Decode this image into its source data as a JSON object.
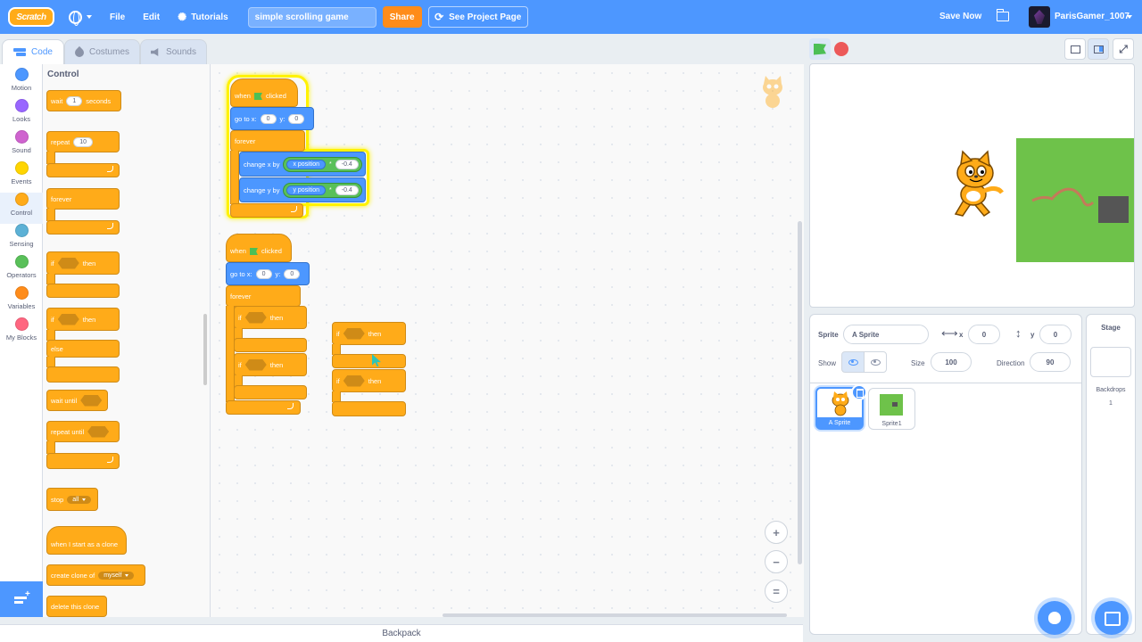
{
  "menubar": {
    "logo": "Scratch",
    "file": "File",
    "edit": "Edit",
    "tutorials": "Tutorials",
    "project_title": "simple scrolling game",
    "share": "Share",
    "see_project_page": "See Project Page",
    "save_now": "Save Now",
    "username": "ParisGamer_1007"
  },
  "tabs": {
    "code": "Code",
    "costumes": "Costumes",
    "sounds": "Sounds"
  },
  "categories": [
    {
      "label": "Motion",
      "color": "#4c97ff"
    },
    {
      "label": "Looks",
      "color": "#9966ff"
    },
    {
      "label": "Sound",
      "color": "#cf63cf"
    },
    {
      "label": "Events",
      "color": "#ffd500"
    },
    {
      "label": "Control",
      "color": "#ffab19"
    },
    {
      "label": "Sensing",
      "color": "#5cb1d6"
    },
    {
      "label": "Operators",
      "color": "#59c059"
    },
    {
      "label": "Variables",
      "color": "#ff8c1a"
    },
    {
      "label": "My Blocks",
      "color": "#ff6680"
    }
  ],
  "palette": {
    "title": "Control",
    "wait": "wait",
    "wait_value": "1",
    "seconds": "seconds",
    "repeat": "repeat",
    "repeat_value": "10",
    "forever": "forever",
    "if": "if",
    "then": "then",
    "else": "else",
    "wait_until": "wait until",
    "repeat_until": "repeat until",
    "stop": "stop",
    "stop_value": "all",
    "when_clone": "when I start as a clone",
    "create_clone": "create clone of",
    "create_clone_value": "myself",
    "delete_clone": "delete this clone"
  },
  "script1": {
    "when": "when",
    "clicked": "clicked",
    "goto": "go to x:",
    "x_val": "0",
    "y_label": "y:",
    "y_val": "0",
    "forever": "forever",
    "change_x": "change x by",
    "x_position": "x position",
    "times": "*",
    "mult1": "-0.4",
    "change_y": "change y by",
    "y_position": "y position",
    "mult2": "-0.4"
  },
  "script2": {
    "when": "when",
    "clicked": "clicked",
    "goto": "go to x:",
    "x_val": "0",
    "y_label": "y:",
    "y_val": "0",
    "forever": "forever",
    "if": "if",
    "then": "then"
  },
  "script3": {
    "if": "if",
    "then": "then"
  },
  "backpack": "Backpack",
  "sprite_info": {
    "sprite_label": "Sprite",
    "sprite_name": "A Sprite",
    "x_label": "x",
    "x_value": "0",
    "y_label": "y",
    "y_value": "0",
    "show_label": "Show",
    "size_label": "Size",
    "size_value": "100",
    "direction_label": "Direction",
    "direction_value": "90"
  },
  "sprites": [
    {
      "name": "A Sprite"
    },
    {
      "name": "Sprite1"
    }
  ],
  "stage_pane": {
    "title": "Stage",
    "backdrops_label": "Backdrops",
    "backdrops_count": "1"
  },
  "zoom": {
    "zoom_in": "+",
    "zoom_out": "−",
    "reset": "="
  }
}
